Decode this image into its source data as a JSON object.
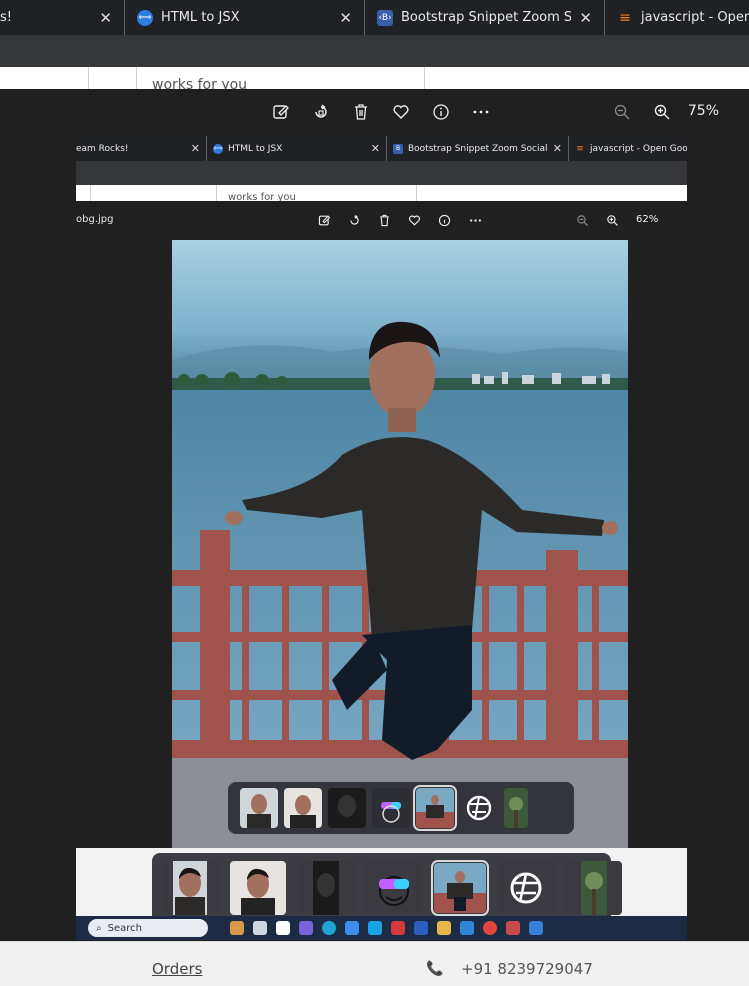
{
  "browser": {
    "tabs": [
      {
        "label": "s!",
        "icon": "none",
        "close": "✕"
      },
      {
        "label": "HTML to JSX",
        "icon": "html-to-jsx-favicon",
        "close": "✕"
      },
      {
        "label": "Bootstrap Snippet Zoom Social Ic",
        "icon": "bootstrap-favicon",
        "close": "✕"
      },
      {
        "label": "javascript - Open Goo",
        "icon": "stackoverflow-favicon",
        "close": ""
      }
    ],
    "page_peek_text": "works for you"
  },
  "viewer": {
    "zoom": "75%",
    "tools": [
      "edit-image-icon",
      "rotate-icon",
      "delete-icon",
      "favorite-icon",
      "info-icon",
      "more-icon",
      "zoom-out-icon",
      "zoom-in-icon"
    ]
  },
  "inner": {
    "tabs": [
      {
        "label": "eam Rocks!",
        "close": "✕"
      },
      {
        "label": "HTML to JSX",
        "close": "✕"
      },
      {
        "label": "Bootstrap Snippet Zoom Social Ic",
        "close": "✕"
      },
      {
        "label": "javascript - Open Goog",
        "close": ""
      }
    ],
    "page_peek_text": "works for you",
    "filename": "obg.jpg",
    "zoom": "62%",
    "search_label": "Search"
  },
  "filmstrip": {
    "thumbs": [
      "portrait-thumb",
      "portrait-thumb-2",
      "dark-thumb",
      "avatar-thumb",
      "selected-photo-thumb",
      "logo-thumb",
      "plant-thumb"
    ],
    "selected_index": 4
  },
  "footer": {
    "orders_label": "Orders",
    "phone_icon": "phone-icon",
    "phone": "+91 8239729047"
  },
  "colors": {
    "tab_bg": "#202124",
    "viewer_bg": "#202020",
    "footer_bg": "#f1f1f1",
    "taskbar_bg": "#1c2a44"
  }
}
